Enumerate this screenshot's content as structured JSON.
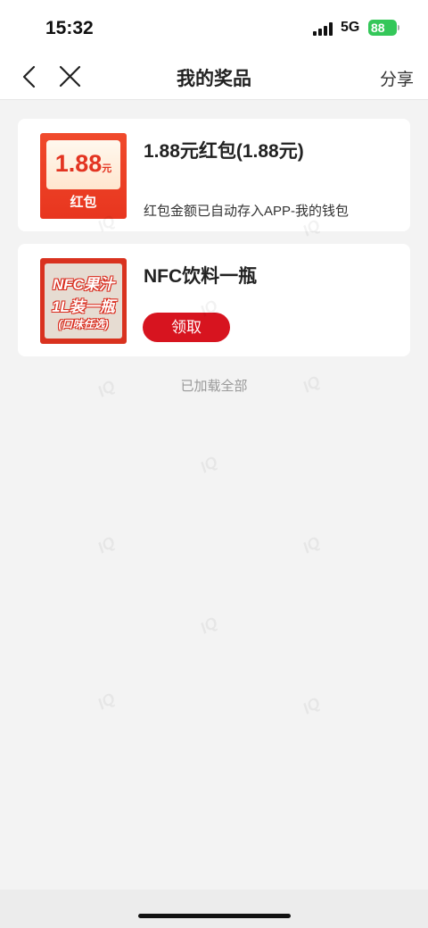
{
  "status_bar": {
    "time": "15:32",
    "network": "5G",
    "battery": "88"
  },
  "nav": {
    "title": "我的奖品",
    "share_label": "分享",
    "back_icon": "chevron-left-icon",
    "close_icon": "close-icon"
  },
  "prizes": [
    {
      "title": "1.88元红包(1.88元)",
      "description": "红包金额已自动存入APP-我的钱包",
      "thumb": {
        "amount": "1.88",
        "unit": "元",
        "label": "红包"
      }
    },
    {
      "title": "NFC饮料一瓶",
      "action_label": "领取",
      "thumb": {
        "line1": "NFC果汁",
        "line2": "1L装一瓶",
        "line3": "(口味任选)"
      }
    }
  ],
  "list_footer": "已加载全部",
  "watermark_text": "IQ",
  "colors": {
    "accent_red": "#d7141f",
    "background": "#f3f3f3",
    "battery_green": "#34c759"
  }
}
